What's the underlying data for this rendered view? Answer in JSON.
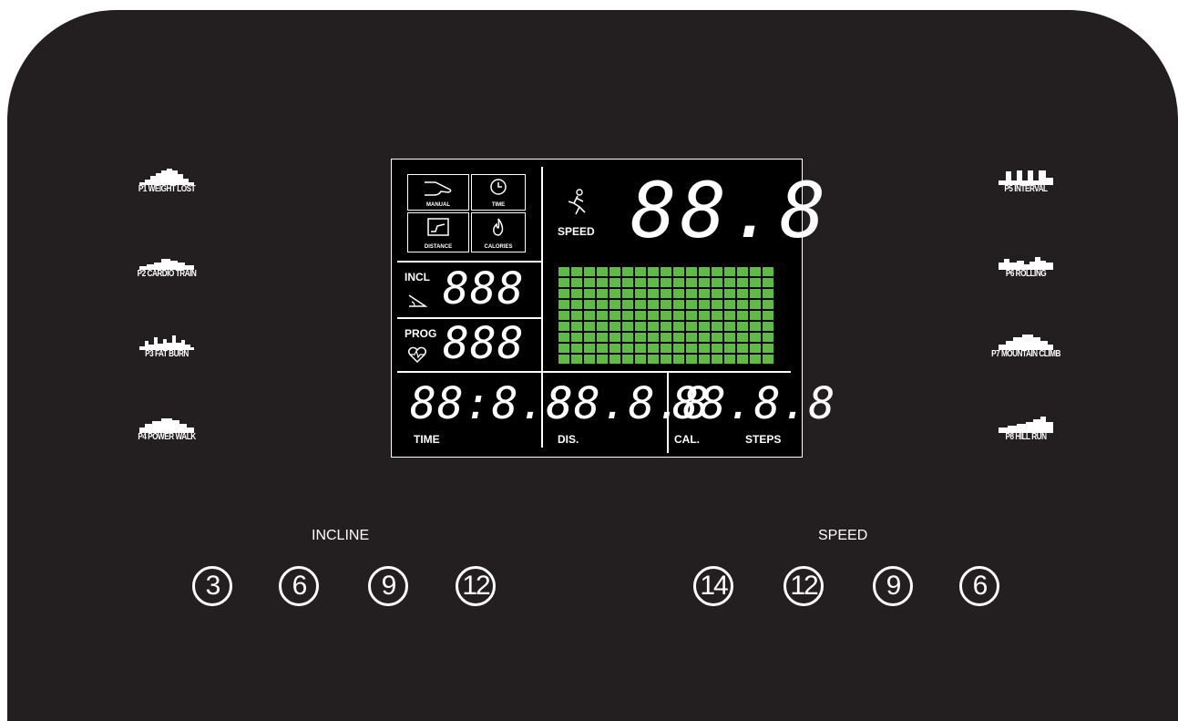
{
  "programs_left": [
    {
      "label": "P1 WEIGHT LOST"
    },
    {
      "label": "P2 CARDIO TRAIN"
    },
    {
      "label": "P3 FAT BURN"
    },
    {
      "label": "P4 POWER WALK"
    }
  ],
  "programs_right": [
    {
      "label": "P5 INTERVAL"
    },
    {
      "label": "P6 ROLLING"
    },
    {
      "label": "P7 MOUNTAIN CLIMB"
    },
    {
      "label": "P8 HILL RUN"
    }
  ],
  "lcd": {
    "modes": [
      "MANUAL",
      "TIME",
      "DISTANCE",
      "CALORIES"
    ],
    "incl_label": "INCL",
    "incl_value": "888",
    "prog_label": "PROG",
    "prog_value": "888",
    "speed_label": "SPEED",
    "speed_value": "88.8",
    "time_value": "88:8.8",
    "time_label": "TIME",
    "dis_value": "88.8.8",
    "dis_label": "DIS.",
    "cal_value": "88.8.8",
    "cal_label": "CAL.",
    "steps_label": "STEPS",
    "grid_color": "#5dbb46"
  },
  "incline": {
    "label": "INCLINE",
    "keys": [
      "3",
      "6",
      "9",
      "12"
    ]
  },
  "speed": {
    "label": "SPEED",
    "keys": [
      "14",
      "12",
      "9",
      "6"
    ]
  }
}
